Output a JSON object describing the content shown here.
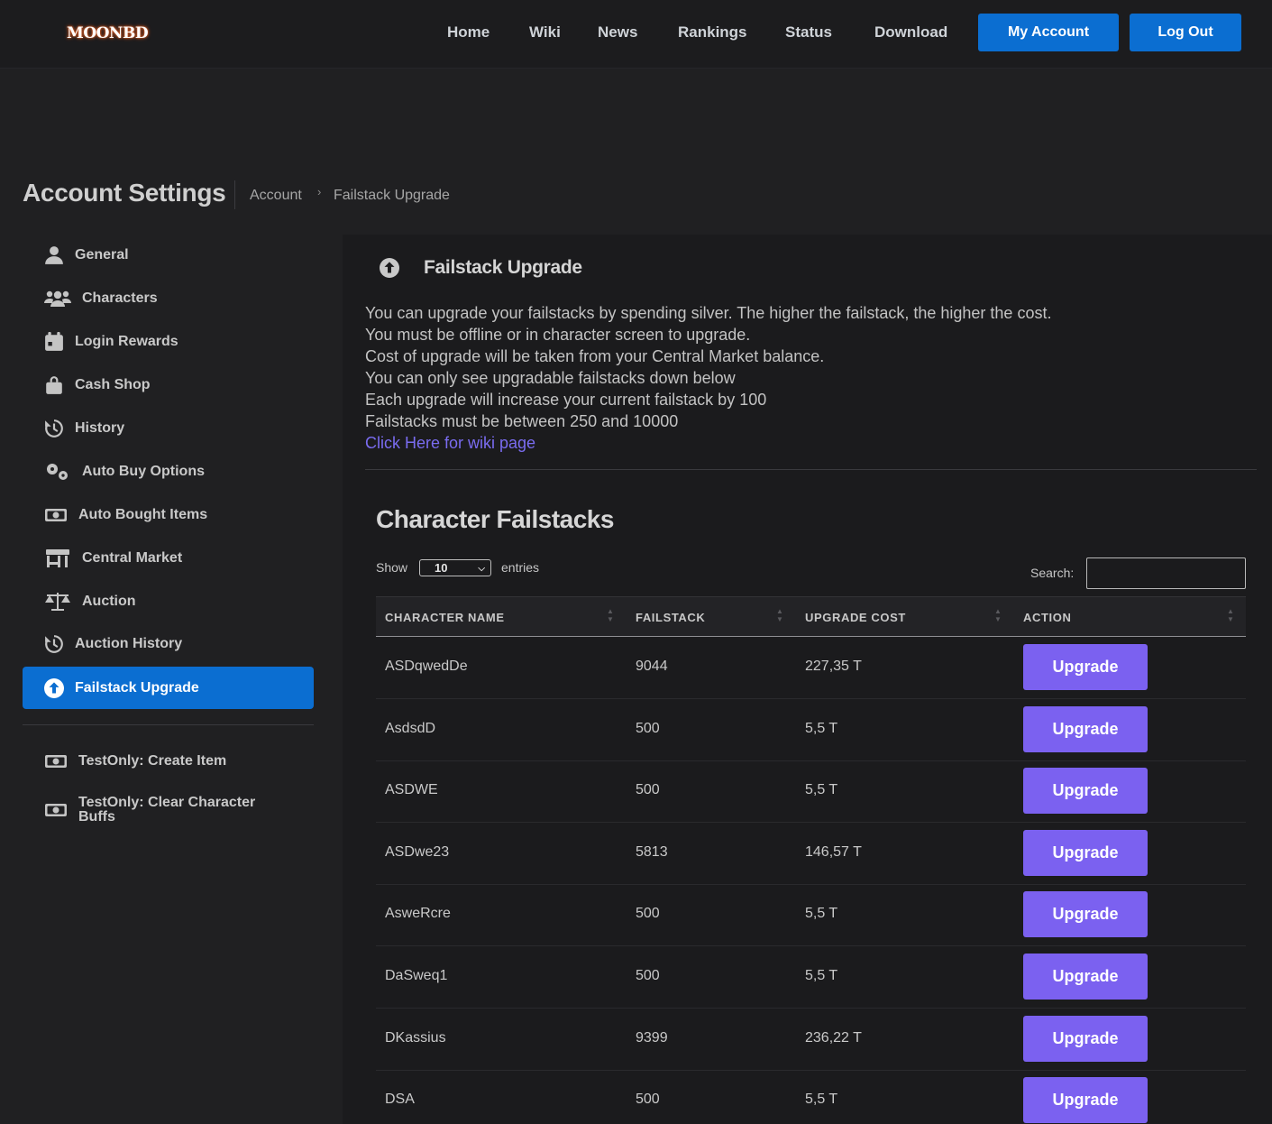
{
  "header": {
    "logo": "MOONBD",
    "nav": [
      "Home",
      "Wiki",
      "News",
      "Rankings",
      "Status",
      "Download"
    ],
    "my_account": "My Account",
    "log_out": "Log Out"
  },
  "page": {
    "title": "Account Settings",
    "breadcrumb": [
      "Account",
      "Failstack Upgrade"
    ]
  },
  "sidebar": {
    "items": [
      {
        "label": "General",
        "icon": "user-icon"
      },
      {
        "label": "Characters",
        "icon": "users-icon"
      },
      {
        "label": "Login Rewards",
        "icon": "calendar-icon"
      },
      {
        "label": "Cash Shop",
        "icon": "shopping-bag-icon"
      },
      {
        "label": "History",
        "icon": "history-icon"
      },
      {
        "label": "Auto Buy Options",
        "icon": "gears-icon"
      },
      {
        "label": "Auto Bought Items",
        "icon": "money-bill-icon"
      },
      {
        "label": "Central Market",
        "icon": "store-icon"
      },
      {
        "label": "Auction",
        "icon": "scale-icon"
      },
      {
        "label": "Auction History",
        "icon": "history-icon"
      },
      {
        "label": "Failstack Upgrade",
        "icon": "arrow-up-circle-icon",
        "active": true
      }
    ],
    "test_items": [
      {
        "label": "TestOnly: Create Item",
        "icon": "money-bill-icon"
      },
      {
        "label": "TestOnly: Clear Character Buffs",
        "icon": "money-bill-icon"
      }
    ]
  },
  "panel": {
    "title": "Failstack Upgrade",
    "info": [
      "You can upgrade your failstacks by spending silver. The higher the failstack, the higher the cost.",
      "You must be offline or in character screen to upgrade.",
      "Cost of upgrade will be taken from your Central Market balance.",
      "You can only see upgradable failstacks down below",
      "Each upgrade will increase your current failstack by 100",
      "Failstacks must be between 250 and 10000"
    ],
    "wiki_link": "Click Here for wiki page"
  },
  "table": {
    "title": "Character Failstacks",
    "show_label": "Show",
    "entries_value": "10",
    "entries_label": "entries",
    "search_label": "Search:",
    "search_value": "",
    "columns": [
      "CHARACTER NAME",
      "FAILSTACK",
      "UPGRADE COST",
      "ACTION"
    ],
    "action_label": "Upgrade",
    "rows": [
      {
        "name": "ASDqwedDe",
        "failstack": "9044",
        "cost": "227,35 T"
      },
      {
        "name": "AsdsdD",
        "failstack": "500",
        "cost": "5,5 T"
      },
      {
        "name": "ASDWE",
        "failstack": "500",
        "cost": "5,5 T"
      },
      {
        "name": "ASDwe23",
        "failstack": "5813",
        "cost": "146,57 T"
      },
      {
        "name": "AsweRcre",
        "failstack": "500",
        "cost": "5,5 T"
      },
      {
        "name": "DaSweq1",
        "failstack": "500",
        "cost": "5,5 T"
      },
      {
        "name": "DKassius",
        "failstack": "9399",
        "cost": "236,22 T"
      },
      {
        "name": "DSA",
        "failstack": "500",
        "cost": "5,5 T"
      }
    ]
  },
  "colors": {
    "primary_blue": "#0b6ed1",
    "upgrade_purple": "#7b61f0",
    "link_purple": "#7a6cf0"
  }
}
